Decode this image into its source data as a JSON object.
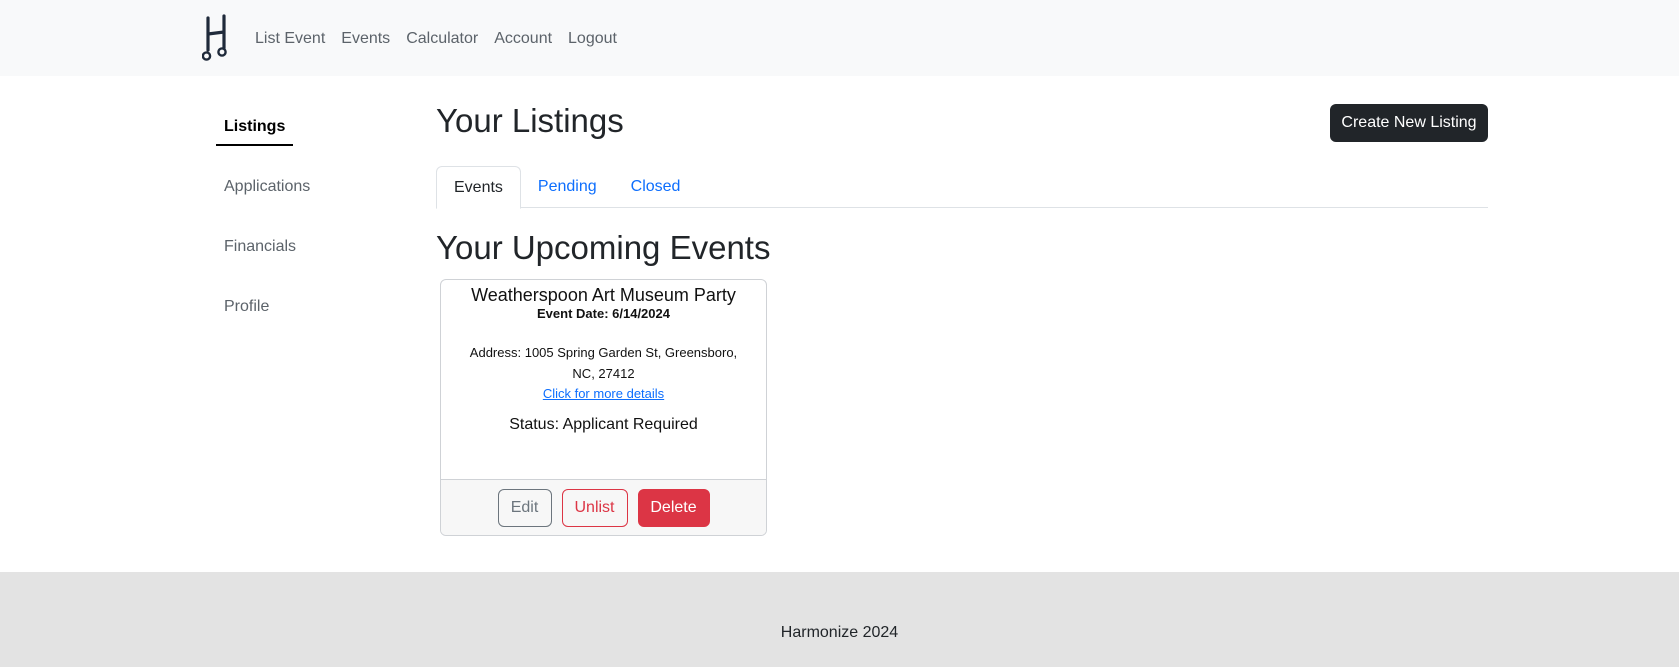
{
  "navbar": {
    "logo_icon": "music-note-h-icon",
    "links": [
      {
        "label": "List Event"
      },
      {
        "label": "Events"
      },
      {
        "label": "Calculator"
      },
      {
        "label": "Account"
      },
      {
        "label": "Logout"
      }
    ]
  },
  "sidebar": {
    "items": [
      {
        "label": "Listings",
        "active": true
      },
      {
        "label": "Applications"
      },
      {
        "label": "Financials"
      },
      {
        "label": "Profile"
      }
    ]
  },
  "main": {
    "title": "Your Listings",
    "create_button": "Create New Listing",
    "tabs": [
      {
        "label": "Events",
        "active": true
      },
      {
        "label": "Pending"
      },
      {
        "label": "Closed"
      }
    ],
    "section_title": "Your Upcoming Events",
    "event_card": {
      "title": "Weatherspoon Art Museum Party",
      "date": "Event Date: 6/14/2024",
      "address": "Address: 1005 Spring Garden St, Greensboro, NC, 27412",
      "details_link": "Click for more details",
      "status": "Status: Applicant Required",
      "edit_label": "Edit",
      "unlist_label": "Unlist",
      "delete_label": "Delete"
    }
  },
  "footer": {
    "text": "Harmonize 2024"
  },
  "colors": {
    "primary_link": "#0d6efd",
    "danger": "#dc3545",
    "dark": "#212529",
    "navbar_bg": "#f8f9fa",
    "footer_bg": "#e3e3e3"
  }
}
